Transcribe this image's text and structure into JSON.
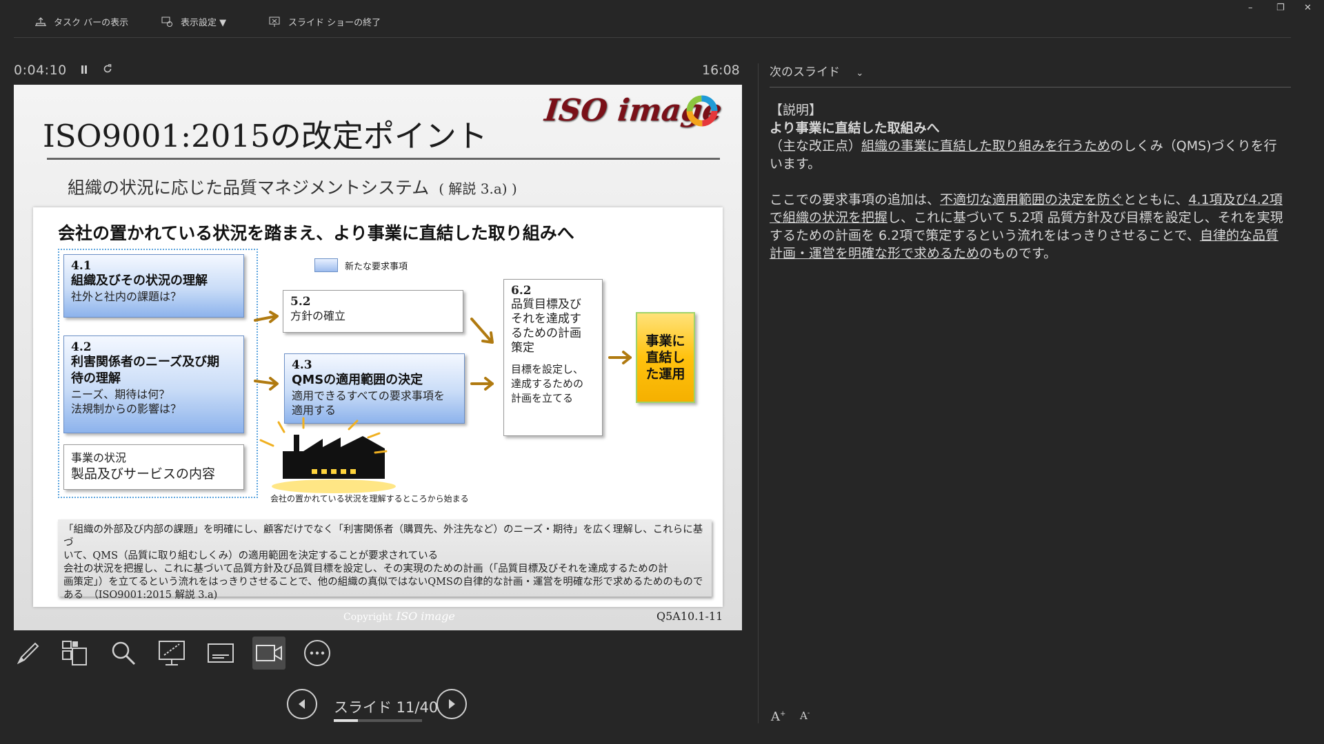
{
  "toolbar": {
    "taskbar_label": "タスク バーの表示",
    "display_settings_label": "表示設定 ▼",
    "end_show_label": "スライド ショーの終了"
  },
  "window": {
    "minimize": "–",
    "restore": "❐",
    "close": "✕"
  },
  "timer": {
    "elapsed": "0:04:10",
    "pause_icon": "pause-icon",
    "reset_icon": "reset-icon",
    "clock": "16:08"
  },
  "slide": {
    "title": "ISO9001:2015の改定ポイント",
    "logo": "ISO image",
    "subtitle": "組織の状況に応じた品質マネジメントシステム",
    "subtitle_ref": "( 解説 3.a) )",
    "panel_heading": "会社の置かれている状況を踏まえ、より事業に直結した取り組みへ",
    "legend": "新たな要求事項",
    "box_41": {
      "num": "4.1",
      "title": "組織及びその状況の理解",
      "text": "社外と社内の課題は？"
    },
    "box_42": {
      "num": "4.2",
      "title1": "利害関係者のニーズ及び期",
      "title2": "待の理解",
      "text1": "ニーズ、期待は何？",
      "text2": "法規制からの影響は？"
    },
    "box_biz": {
      "line1": "事業の状況",
      "line2": "製品及びサービスの内容"
    },
    "box_52": {
      "num": "5.2",
      "text": "方針の確立"
    },
    "box_43": {
      "num": "4.3",
      "title": "QMSの適用範囲の決定",
      "text1": "適用できるすべての要求事項を",
      "text2": "適用する"
    },
    "box_62": {
      "num": "6.2",
      "lines": [
        "品質目標及び",
        "それを達成す",
        "るための計画",
        "策定"
      ],
      "text": [
        "目標を設定し、",
        "達成するための",
        "計画を立てる"
      ]
    },
    "box_result": [
      "事業に",
      "直結し",
      "た運用"
    ],
    "factory_caption": "会社の置かれている状況を理解するところから始まる",
    "note_lines": [
      "「組織の外部及び内部の課題」を明確にし、顧客だけでなく「利害関係者（購買先、外注先など）のニーズ・期待」を広く理解し、これらに基づ",
      "いて、QMS（品質に取り組むしくみ）の適用範囲を決定することが要求されている",
      "会社の状況を把握し、これに基づいて品質方針及び品質目標を設定し、その実現のための計画（「品質目標及びそれを達成するための計",
      "画策定」）を立てるという流れをはっきりさせることで、他の組織の真似ではないQMSの自律的な計画・運営を明確な形で求めるためのもので",
      "ある　（ISO9001:2015  解説 3.a)"
    ],
    "footer_copyright": "Copyright",
    "footer_logo": "ISO image",
    "code": "Q5A10.1-11"
  },
  "tools": [
    "pen-icon",
    "all-slides-icon",
    "zoom-icon",
    "pointer-icon",
    "subtitles-icon",
    "camera-icon",
    "more-icon"
  ],
  "navigation": {
    "counter": "スライド 11/40",
    "progress": 0.275
  },
  "notes_pane": {
    "next_slide_label": "次のスライド",
    "heading": "【説明】",
    "bold_line": "より事業に直結した取組みへ",
    "p1_a": "（主な改正点）",
    "p1_u": "組織の事業に直結した取り組みを行うため",
    "p1_b": "のしくみ（QMS)づくりを行います。",
    "p2_a": "ここでの要求事項の追加は、",
    "p2_u1": "不適切な適用範囲の決定を防ぐ",
    "p2_b": "とともに、",
    "p2_u2": "4.1項及び4.2項で組織の状況を把握",
    "p2_c": "し、これに基づいて 5.2項 品質方針及び目標を設定し、それを実現するための計画を 6.2項で策定するという流れをはっきりさせることで、",
    "p2_u3": "自律的な品質計画・運営を明確な形で求めるため",
    "p2_d": "のものです。",
    "font_increase": "A+",
    "font_decrease": "A-"
  }
}
